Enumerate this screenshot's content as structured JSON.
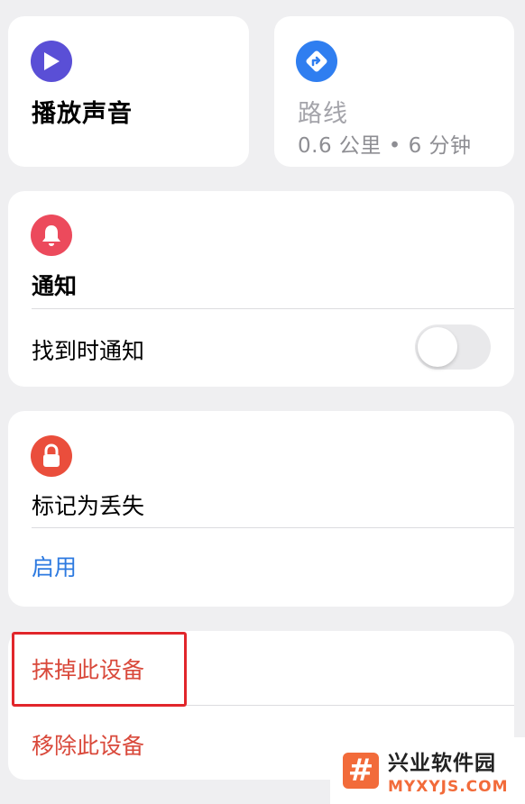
{
  "actions": {
    "play_sound": {
      "icon": "play-icon",
      "label": "播放声音",
      "color": "#5a4fd6"
    },
    "route": {
      "icon": "directions-icon",
      "label": "路线",
      "detail": "0.6 公里 • 6 分钟",
      "color": "#2f7ef0"
    }
  },
  "notify": {
    "icon": "bell-icon",
    "title": "通知",
    "row_label": "找到时通知",
    "toggle_on": false,
    "color": "#ec4a5c"
  },
  "lost_mode": {
    "icon": "lock-icon",
    "title": "标记为丢失",
    "enable_label": "启用",
    "color": "#ea4e3c"
  },
  "device": {
    "erase_label": "抹掉此设备",
    "remove_label": "移除此设备",
    "color": "#d9493b"
  },
  "watermark": {
    "logo_glyph": "#",
    "name": "兴业软件园",
    "url": "MYXYJS.COM"
  }
}
